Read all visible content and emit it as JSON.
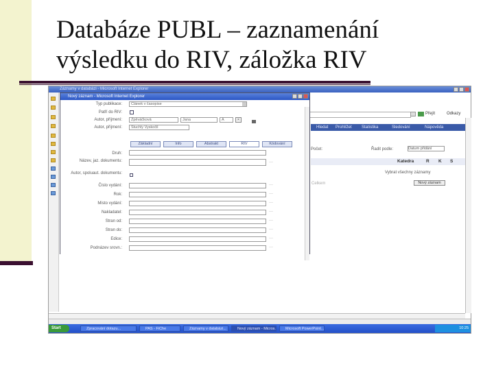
{
  "slide": {
    "title_line1": "Databáze PUBL – zaznamenání",
    "title_line2": "výsledku do RIV, záložka RIV"
  },
  "browser": {
    "title": "Záznamy v databázi - Microsoft Internet Explorer",
    "go_label": "Přejít",
    "links_label": "Odkazy",
    "nav_tabs": [
      "Hledat",
      "Prohlížet",
      "Statistika",
      "Sledování",
      "Nápověda"
    ],
    "background_text": {
      "sort_label": "Řadit podle:",
      "sort_value": "Datum přidání",
      "show_label": "Počet:",
      "column_katedra": "Katedra",
      "col_r": "R",
      "col_k": "K",
      "col_s": "S",
      "note": "Vybrat všechny záznamy",
      "new_record_button": "Nový záznam",
      "side_text": "Celkem"
    }
  },
  "dialog": {
    "title": "Nový záznam - Microsoft Internet Explorer",
    "fields": {
      "typ_publikace_label": "Typ publikace:",
      "typ_publikace_value": "Článek v časopise",
      "patri_do_riv_label": "Patří do RIV:",
      "autor1_label": "Autor, příjmení:",
      "autor1_surname": "Zpěváčková",
      "autor1_name": "Jana",
      "autor1_type": "A",
      "autor2_label": "Autor, příjmení:",
      "autor2_value": "Stuchly Vyskočil"
    },
    "tabs": [
      "Základní",
      "Info",
      "Abstrakt",
      "RIV",
      "Kódování"
    ],
    "riv_fields": [
      "Druh:",
      "Název, jaz. dokumentu:",
      "Autor, spoluaut. dokumentu:",
      "Číslo vydání:",
      "Rok:",
      "Místo vydání:",
      "Nakladatel:",
      "Stran od:",
      "Stran do:",
      "Edice:",
      "Podnázev srovn.:"
    ]
  },
  "taskbar": {
    "start": "Start",
    "tasks": [
      "Zpracování dotazu...",
      "PAS - FiChe",
      "Záznamy v databázi...",
      "Nový záznam - Micros...",
      "Microsoft PowerPoint..."
    ],
    "clock": "10:25"
  }
}
